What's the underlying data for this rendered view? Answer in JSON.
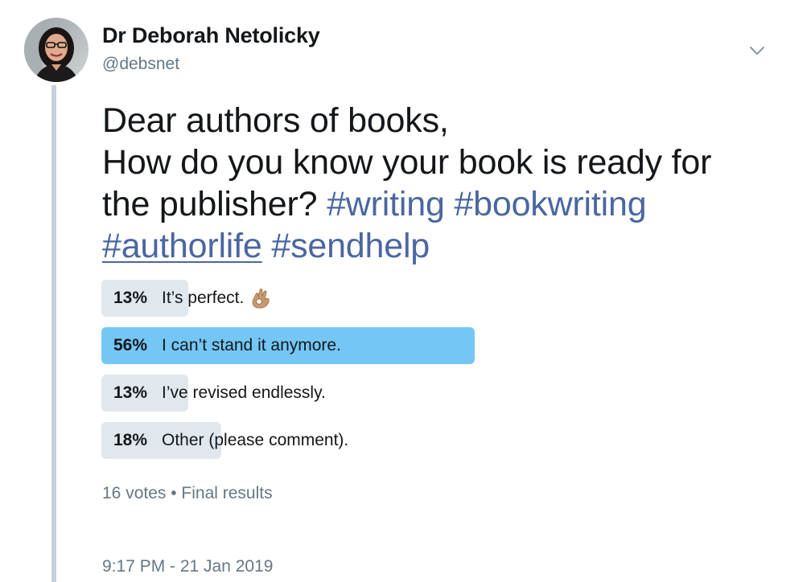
{
  "author": {
    "name": "Dr Deborah Netolicky",
    "handle": "@debsnet"
  },
  "tweet": {
    "line1": "Dear authors of books,",
    "line2": "How do you know your book is ready for",
    "line3_text": "the publisher? ",
    "hashtags": [
      "#writing",
      "#bookwriting",
      "#authorlife",
      "#sendhelp"
    ]
  },
  "poll": {
    "options": [
      {
        "percent": "13%",
        "text": "It’s perfect.",
        "emoji": "ok-hand-icon",
        "share": 0.13,
        "winner": false
      },
      {
        "percent": "56%",
        "text": "I can’t stand it anymore.",
        "share": 0.56,
        "winner": true
      },
      {
        "percent": "13%",
        "text": "I’ve revised endlessly.",
        "share": 0.13,
        "winner": false
      },
      {
        "percent": "18%",
        "text": "Other (please comment).",
        "share": 0.18,
        "winner": false
      }
    ],
    "footer": "16 votes • Final results"
  },
  "timestamp": "9:17 PM - 21 Jan 2019",
  "colors": {
    "hashtag": "#4a67a0",
    "winner_bar": "#74c7f5",
    "bar": "#e1e8ed",
    "muted": "#657786",
    "thread_line": "#c5d0dc"
  }
}
